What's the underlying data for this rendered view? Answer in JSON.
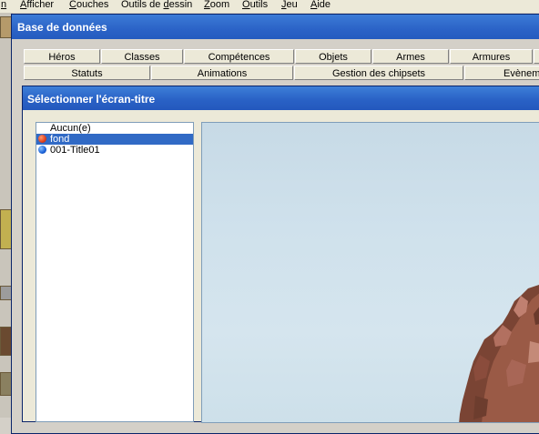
{
  "menubar": {
    "items": [
      {
        "pre": "",
        "u": "n",
        "post": ""
      },
      {
        "pre": "",
        "u": "A",
        "post": "fficher"
      },
      {
        "pre": "",
        "u": "C",
        "post": "ouches"
      },
      {
        "pre": "Outils de ",
        "u": "d",
        "post": "essin"
      },
      {
        "pre": "",
        "u": "Z",
        "post": "oom"
      },
      {
        "pre": "",
        "u": "O",
        "post": "utils"
      },
      {
        "pre": "",
        "u": "J",
        "post": "eu"
      },
      {
        "pre": "",
        "u": "A",
        "post": "ide"
      }
    ]
  },
  "database_window": {
    "title": "Base de données",
    "tabs_row1": [
      "Héros",
      "Classes",
      "Compétences",
      "Objets",
      "Armes",
      "Armures",
      ""
    ],
    "tabs_row2": [
      "Statuts",
      "Animations",
      "Gestion des chipsets",
      "Evènem"
    ]
  },
  "dialog": {
    "title": "Sélectionner l'écran-titre",
    "list_items": [
      {
        "label": "Aucun(e)",
        "icon": "",
        "selected": false
      },
      {
        "label": "fond",
        "icon": "red-ball-icon",
        "selected": true
      },
      {
        "label": "001-Title01",
        "icon": "blue-ball-icon",
        "selected": false
      }
    ]
  },
  "colors": {
    "title_blue": "#2b63c7",
    "selection": "#316ac5",
    "red_ball": "#e0401c",
    "blue_ball": "#1860d8"
  }
}
